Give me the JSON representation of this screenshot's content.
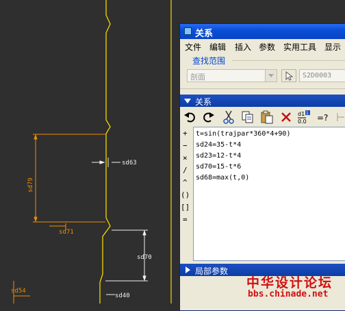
{
  "cad": {
    "dims": {
      "d63": "sd63",
      "d79": "sd79",
      "d71": "sd71",
      "d70": "sd70",
      "d54": "sd54",
      "d40": "sd40"
    }
  },
  "window": {
    "title": "关系",
    "icon": "app-window-icon"
  },
  "menu": [
    "文件",
    "编辑",
    "插入",
    "参数",
    "实用工具",
    "显示"
  ],
  "search": {
    "group_label": "查找范围",
    "combo_value": "剖面",
    "selection_value": "S2D0003"
  },
  "relations": {
    "section_label": "关系",
    "toolbar_icons": [
      "undo-icon",
      "redo-icon",
      "cut-icon",
      "copy-icon",
      "paste-icon",
      "delete-icon",
      "evaluate-icon",
      "verify-icon"
    ],
    "operators": [
      "+",
      "−",
      "×",
      "/",
      "^",
      "()",
      "[]",
      "="
    ],
    "lines": [
      "t=sin(trajpar*360*4+90)",
      "sd24=35-t*4",
      "sd23=12-t*4",
      "sd70=15-t*6",
      "sd68=max(t,0)"
    ]
  },
  "local_params": {
    "section_label": "局部参数"
  },
  "watermark": {
    "line1": "中华设计论坛",
    "line2": "bbs.chinade.net"
  },
  "colors": {
    "cad_background": "#2f2f2f",
    "profile_yellow": "#f5d800",
    "dimension_orange": "#f08c00",
    "dimension_white": "#f0f0f0",
    "title_blue": "#0a4fd8",
    "watermark_red": "#d01010"
  }
}
